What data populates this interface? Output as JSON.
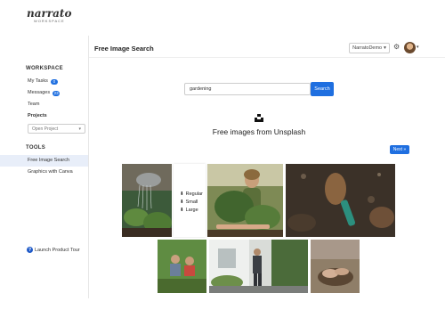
{
  "app": {
    "logo_main": "narrato",
    "logo_sub": "WORKSPACE"
  },
  "header": {
    "title": "Free Image Search",
    "user_name": "NarratoDemo",
    "caret": "▾",
    "gear_glyph": "⚙"
  },
  "sidebar": {
    "workspace_label": "WORKSPACE",
    "items": [
      {
        "label": "My Tasks",
        "badge": "0"
      },
      {
        "label": "Messages",
        "badge": "23"
      },
      {
        "label": "Team"
      },
      {
        "label": "Projects"
      }
    ],
    "open_project_placeholder": "Open Project",
    "tools_label": "TOOLS",
    "tools": [
      {
        "label": "Free Image Search",
        "active": true
      },
      {
        "label": "Graphics with Canva",
        "active": false
      }
    ],
    "tour_label": "Launch Product Tour",
    "tour_glyph": "?"
  },
  "search": {
    "value": "gardening",
    "button_label": "Search"
  },
  "results": {
    "headline": "Free images from Unsplash",
    "next_label": "Next »",
    "download_options": [
      "Regular",
      "Small",
      "Large"
    ],
    "download_glyph": "⬇"
  },
  "colors": {
    "accent": "#1f6fe0",
    "active_bg": "#e8eef9"
  }
}
